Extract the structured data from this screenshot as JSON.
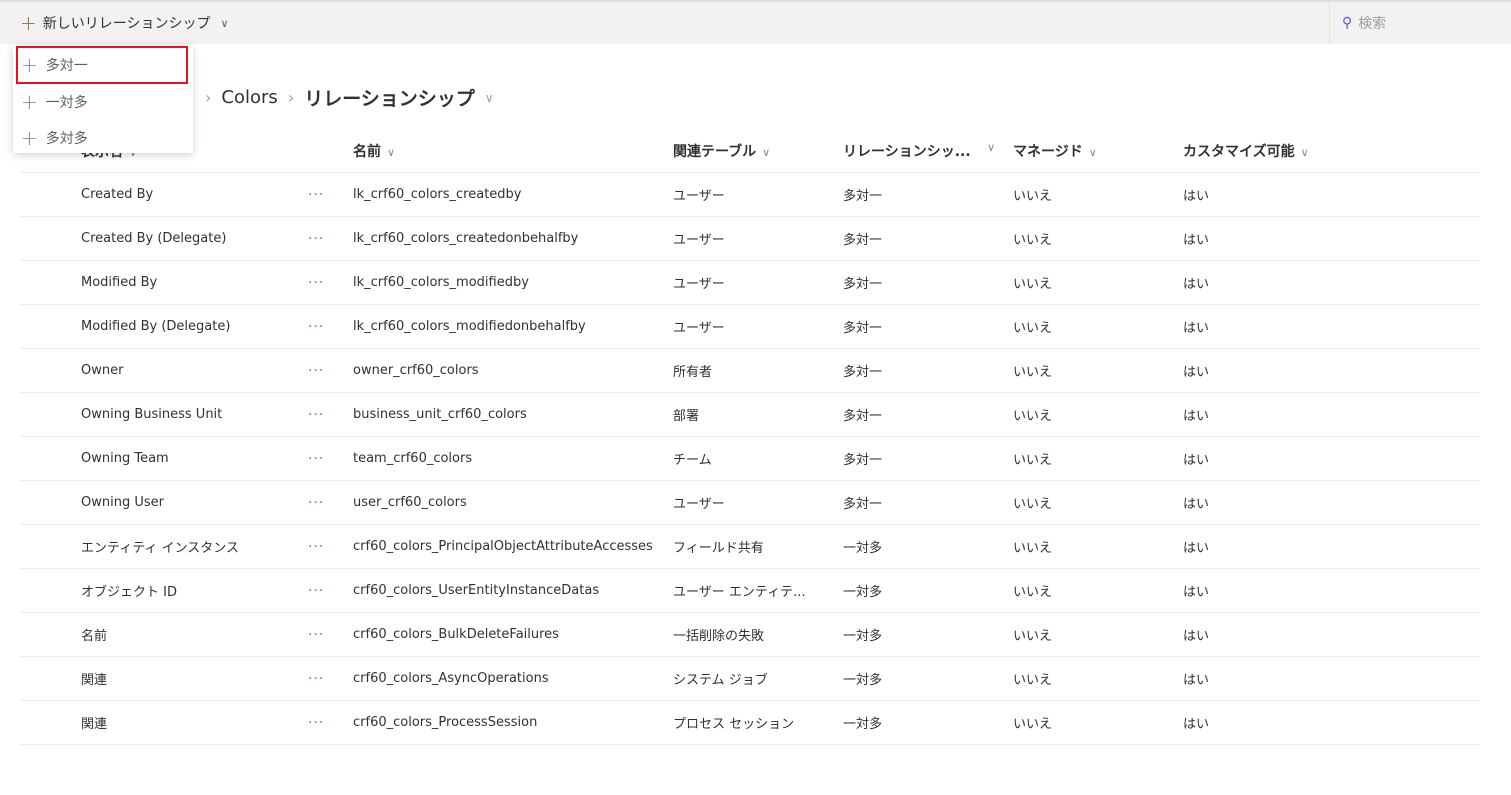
{
  "toolbar": {
    "new_relationship": "新しいリレーションシップ",
    "search_placeholder": "検索"
  },
  "menu": {
    "items": [
      {
        "label": "多対一"
      },
      {
        "label": "一対多"
      },
      {
        "label": "多対多"
      }
    ]
  },
  "breadcrumb": {
    "items": [
      "Colors"
    ],
    "current": "リレーションシップ"
  },
  "table": {
    "headers": [
      "表示名",
      "名前",
      "関連テーブル",
      "リレーションシッ...",
      "マネージド",
      "カスタマイズ可能"
    ],
    "rows": [
      [
        "Created By",
        "lk_crf60_colors_createdby",
        "ユーザー",
        "多対一",
        "いいえ",
        "はい"
      ],
      [
        "Created By (Delegate)",
        "lk_crf60_colors_createdonbehalfby",
        "ユーザー",
        "多対一",
        "いいえ",
        "はい"
      ],
      [
        "Modified By",
        "lk_crf60_colors_modifiedby",
        "ユーザー",
        "多対一",
        "いいえ",
        "はい"
      ],
      [
        "Modified By (Delegate)",
        "lk_crf60_colors_modifiedonbehalfby",
        "ユーザー",
        "多対一",
        "いいえ",
        "はい"
      ],
      [
        "Owner",
        "owner_crf60_colors",
        "所有者",
        "多対一",
        "いいえ",
        "はい"
      ],
      [
        "Owning Business Unit",
        "business_unit_crf60_colors",
        "部署",
        "多対一",
        "いいえ",
        "はい"
      ],
      [
        "Owning Team",
        "team_crf60_colors",
        "チーム",
        "多対一",
        "いいえ",
        "はい"
      ],
      [
        "Owning User",
        "user_crf60_colors",
        "ユーザー",
        "多対一",
        "いいえ",
        "はい"
      ],
      [
        "エンティティ インスタンス",
        "crf60_colors_PrincipalObjectAttributeAccesses",
        "フィールド共有",
        "一対多",
        "いいえ",
        "はい"
      ],
      [
        "オブジェクト ID",
        "crf60_colors_UserEntityInstanceDatas",
        "ユーザー エンティテ...",
        "一対多",
        "いいえ",
        "はい"
      ],
      [
        "名前",
        "crf60_colors_BulkDeleteFailures",
        "一括削除の失敗",
        "一対多",
        "いいえ",
        "はい"
      ],
      [
        "関連",
        "crf60_colors_AsyncOperations",
        "システム ジョブ",
        "一対多",
        "いいえ",
        "はい"
      ],
      [
        "関連",
        "crf60_colors_ProcessSession",
        "プロセス セッション",
        "一対多",
        "いいえ",
        "はい"
      ]
    ],
    "more_label": "···"
  }
}
